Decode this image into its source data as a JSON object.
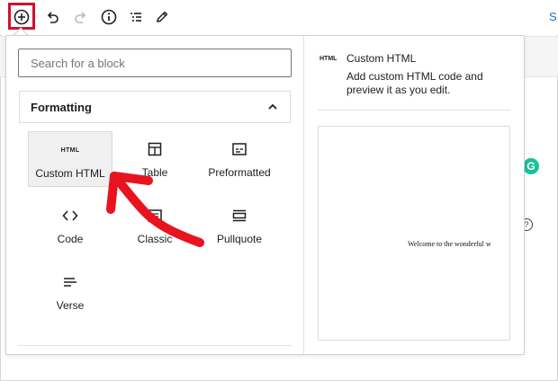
{
  "toolbar": {
    "icons": [
      "plus-circle-icon",
      "undo-icon",
      "redo-icon",
      "info-icon",
      "list-view-icon",
      "pencil-icon"
    ],
    "right_text": "S"
  },
  "background": {
    "grammarly_letter": "G",
    "edge_glyph": "?"
  },
  "inserter": {
    "search_placeholder": "Search for a block",
    "panel_title": "Formatting",
    "blocks": [
      {
        "label": "Custom HTML",
        "icon": "html-icon",
        "icon_text": "HTML"
      },
      {
        "label": "Table",
        "icon": "table-icon"
      },
      {
        "label": "Preformatted",
        "icon": "preformatted-icon"
      },
      {
        "label": "Code",
        "icon": "code-icon"
      },
      {
        "label": "Classic",
        "icon": "classic-icon"
      },
      {
        "label": "Pullquote",
        "icon": "pullquote-icon"
      },
      {
        "label": "Verse",
        "icon": "verse-icon"
      }
    ]
  },
  "preview": {
    "icon_text": "HTML",
    "title": "Custom HTML",
    "description": "Add custom HTML code and preview it as you edit.",
    "sample_text": "Welcome to the wonderful w"
  },
  "colors": {
    "highlight": "#d0112b",
    "arrow": "#e8131f",
    "link": "#2271b1",
    "grammarly": "#15c39a"
  }
}
